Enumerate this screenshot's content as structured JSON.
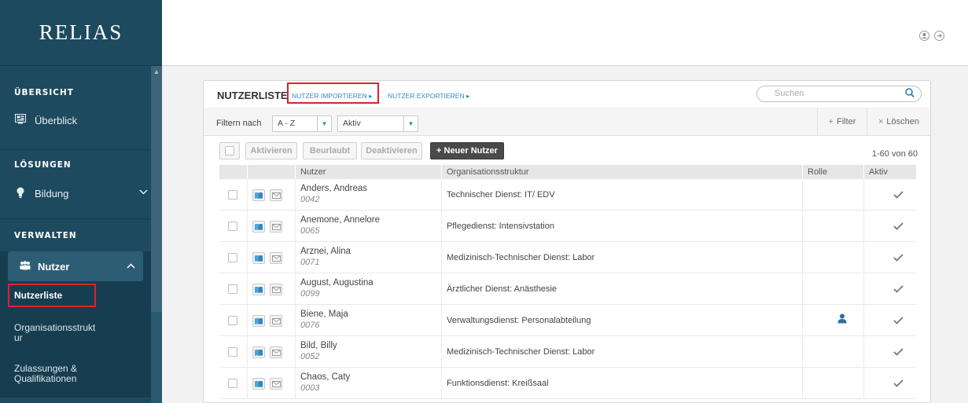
{
  "sidebar": {
    "logo": "RELIAS",
    "sections": {
      "overview": "ÜBERSICHT",
      "solutions": "LÖSUNGEN",
      "admin": "VERWALTEN"
    },
    "items": {
      "overview": "Überblick",
      "education": "Bildung",
      "users": "Nutzer",
      "userlist": "Nutzerliste",
      "orgstructure_1": "Organisationsstrukt",
      "orgstructure_2": "ur",
      "qualifications_1": "Zulassungen &",
      "qualifications_2": "Qualifikationen"
    }
  },
  "panel": {
    "title": "NUTZERLISTE",
    "import_link": "NUTZER IMPORTIEREN ▸",
    "export_link": "NUTZER EXPORTIEREN ▸",
    "search_placeholder": "Suchen",
    "filter_label": "Filtern nach",
    "filter_letters": "A - Z",
    "filter_status": "Aktiv",
    "filter_button": "Filter",
    "clear_button": "Löschen",
    "actions": {
      "activate": "Aktivieren",
      "leave": "Beurlaubt",
      "deactivate": "Deaktivieren",
      "new_user": "+ Neuer Nutzer"
    },
    "count": "1-60 von 60"
  },
  "table": {
    "headers": {
      "user": "Nutzer",
      "org": "Organisationsstruktur",
      "role": "Rolle",
      "active": "Aktiv"
    },
    "rows": [
      {
        "name": "Anders, Andreas",
        "id": "0042",
        "org": "Technischer Dienst: IT/ EDV",
        "role": false,
        "active": true
      },
      {
        "name": "Anemone, Annelore",
        "id": "0065",
        "org": "Pflegedienst: Intensivstation",
        "role": false,
        "active": true
      },
      {
        "name": "Arznei, Alina",
        "id": "0071",
        "org": "Medizinisch-Technischer Dienst: Labor",
        "role": false,
        "active": true
      },
      {
        "name": "August, Augustina",
        "id": "0099",
        "org": "Ärztlicher Dienst: Anästhesie",
        "role": false,
        "active": true
      },
      {
        "name": "Biene, Maja",
        "id": "0076",
        "org": "Verwaltungsdienst: Personalabteilung",
        "role": true,
        "active": true
      },
      {
        "name": "Bild, Billy",
        "id": "0052",
        "org": "Medizinisch-Technischer Dienst: Labor",
        "role": false,
        "active": true
      },
      {
        "name": "Chaos, Caty",
        "id": "0003",
        "org": "Funktionsdienst: Kreißsaal",
        "role": false,
        "active": true
      }
    ]
  },
  "colors": {
    "sidebar": "#1e4a5f",
    "highlight": "#d9232e",
    "link": "#2d8dc4"
  }
}
